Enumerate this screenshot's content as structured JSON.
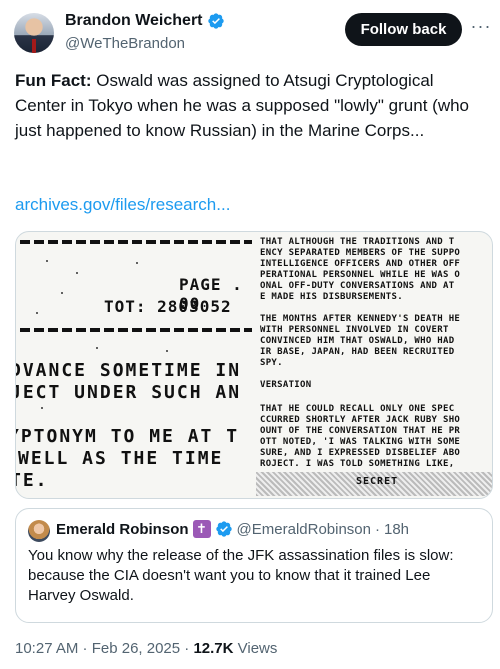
{
  "author": {
    "display_name": "Brandon Weichert",
    "handle": "@WeTheBrandon",
    "verified_color": "#1d9bf0"
  },
  "actions": {
    "follow_label": "Follow back",
    "more_label": "···"
  },
  "tweet": {
    "text_bold": "Fun Fact:",
    "text_rest": " Oswald was assigned to Atsugi Cryptological Center in Tokyo when he was a supposed \"lowly\" grunt (who just happened to know Russian) in the Marine Corps...",
    "link": "archives.gov/files/research..."
  },
  "document": {
    "page_label": "PAGE . 00",
    "tot_label": "TOT: 2803052",
    "big_lines": [
      "DVANCE SOMETIME IN",
      "JECT UNDER SUCH AN",
      "YPTONYM TO ME AT T",
      "WELL AS THE TIME",
      "TE."
    ],
    "right_lines": [
      "THAT ALTHOUGH THE TRADITIONS AND T",
      "ENCY SEPARATED MEMBERS OF THE SUPPO",
      "INTELLIGENCE OFFICERS AND OTHER OFF",
      "PERATIONAL PERSONNEL WHILE HE WAS O",
      "ONAL OFF-DUTY CONVERSATIONS AND AT",
      "E MADE HIS DISBURSEMENTS.",
      "",
      "THE MONTHS AFTER KENNEDY'S DEATH HE",
      "WITH PERSONNEL INVOLVED IN COVERT",
      "CONVINCED HIM THAT OSWALD, WHO HAD",
      "IR BASE, JAPAN, HAD BEEN RECRUITED",
      "SPY.",
      "VERSATION",
      "",
      "THAT HE COULD RECALL ONLY ONE SPEC",
      "CCURRED SHORTLY AFTER JACK RUBY SHO",
      "OUNT OF THE CONVERSATION THAT HE PR",
      "OTT NOTED, 'I WAS TALKING WITH SOME",
      "SURE, AND I EXPRESSED DISBELIEF ABO",
      "ROJECT.  I WAS TOLD SOMETHING LIKE,"
    ],
    "stamp": "SECRET"
  },
  "quote": {
    "display_name": "Emerald Robinson",
    "badge": "✝",
    "handle": "@EmeraldRobinson",
    "separator": "·",
    "time": "18h",
    "text": "You know why the release of the JFK assassination files is slow: because the CIA doesn't want you to know that it trained Lee Harvey Oswald."
  },
  "meta": {
    "timestamp": "10:27 AM · Feb 26, 2025 · ",
    "views_count": "12.7K",
    "views_label": " Views"
  }
}
